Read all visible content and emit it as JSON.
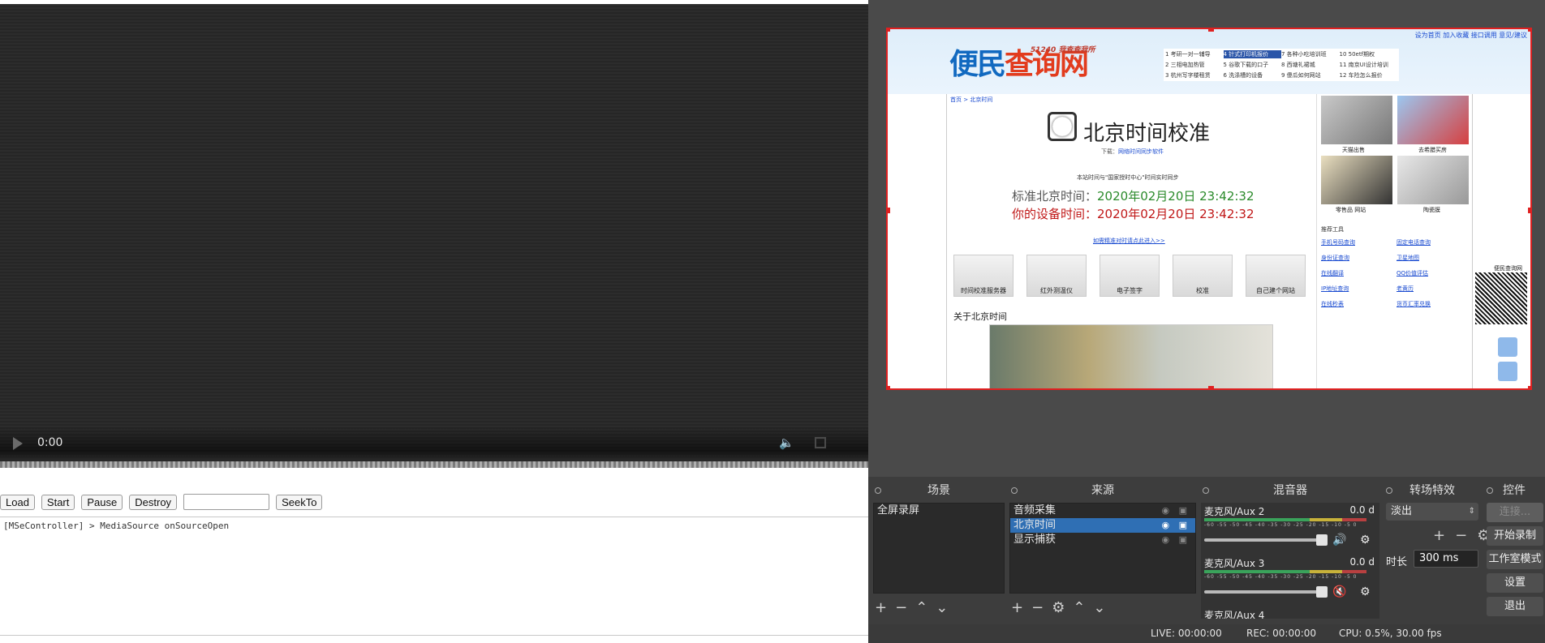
{
  "player": {
    "time": "0:00"
  },
  "toolbar": {
    "load": "Load",
    "start": "Start",
    "pause": "Pause",
    "destroy": "Destroy",
    "seek_value": "",
    "seekto": "SeekTo"
  },
  "log": {
    "line": "[MSeController] > MediaSource onSourceOpen"
  },
  "preview_page": {
    "toplinks": "设为首页  加入收藏  接口调用  意见/建议",
    "logo_a": "便民",
    "logo_b": "查询网",
    "logo_sub": "51240 我查查我所",
    "menu": [
      "1 考研一对一辅导",
      "4 针式打印机报价",
      "7 各种小吃培训班",
      "10 50etf期权",
      "2 三相电加热管",
      "5 谷歌下载的口子",
      "8 西塘礼裙城",
      "11 南京UI设计培训",
      "3 杭州写字楼租赁",
      "6 洗涤槽的设备",
      "9 傻瓜如何网站",
      "12 车险怎么报价"
    ],
    "crumb": "首页 > 北京时间",
    "title": "北京时间校准",
    "download_label": "下载：",
    "download_link": "网络时间同步软件",
    "note": "本站时间与\"国家授时中心\"时间实时同步",
    "std_label": "标准北京时间：",
    "std_value": "2020年02月20日 23:42:32",
    "dev_label": "你的设备时间：",
    "dev_value": "2020年02月20日 23:42:32",
    "more": "如需精准对时请点此进入>>",
    "thumbs": [
      "时间校准服务器",
      "红外测温仪",
      "电子签字",
      "校准",
      "自己建个网站"
    ],
    "about": "关于北京时间",
    "images": [
      "天猫出售",
      "去希腊买房",
      "零售品 网站",
      "陶瓷膜"
    ],
    "tools_title": "推荐工具",
    "tools": [
      "手机号码查询",
      "固定电话查询",
      "身份证查询",
      "卫星地图",
      "在线翻译",
      "QQ价值评估",
      "IP地址查询",
      "老黄历",
      "在线秒表",
      "货币汇率兑换"
    ],
    "qr_caption": "便民查询网"
  },
  "obs": {
    "docks": {
      "scenes": {
        "title": "场景",
        "items": [
          "全屏录屏"
        ]
      },
      "sources": {
        "title": "来源",
        "items": [
          "音频采集",
          "北京时间",
          "显示捕获"
        ],
        "selected": 1
      },
      "mixer": {
        "title": "混音器",
        "channels": [
          {
            "name": "麦克风/Aux 2",
            "db": "0.0 d",
            "muted": false
          },
          {
            "name": "麦克风/Aux 3",
            "db": "0.0 d",
            "muted": true
          },
          {
            "name": "麦克风/Aux 4",
            "db": ""
          }
        ],
        "scale": "-60 -55 -50 -45 -40 -35 -30 -25 -20 -15 -10 -5 0"
      },
      "transitions": {
        "title": "转场特效",
        "selected": "淡出",
        "duration_label": "时长",
        "duration": "300 ms"
      },
      "controls": {
        "title": "控件",
        "buttons": [
          "连接...",
          "开始录制",
          "工作室模式",
          "设置",
          "退出"
        ]
      }
    },
    "status": {
      "live": "LIVE: 00:00:00",
      "rec": "REC: 00:00:00",
      "cpu": "CPU: 0.5%, 30.00 fps"
    }
  }
}
